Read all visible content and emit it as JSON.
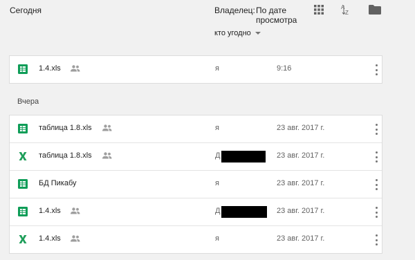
{
  "header": {
    "group_today": "Сегодня",
    "owner_label": "Владелец:",
    "owner_value": "кто угодно",
    "sort_label": "По дате просмотра",
    "icons": [
      "grid-view-icon",
      "sort-az-icon",
      "folder-icon"
    ]
  },
  "colors": {
    "sheets_green": "#0f9d58",
    "excel_green": "#1e9e5a",
    "background": "#f1f1f1"
  },
  "today": [
    {
      "name": "1.4.xls",
      "icon": "google-sheets-icon",
      "shared": true,
      "owner": "я",
      "date": "9:16"
    }
  ],
  "group_yesterday": "Вчера",
  "yesterday": [
    {
      "name": "таблица 1.8.xls",
      "icon": "google-sheets-icon",
      "shared": true,
      "owner": "я",
      "date": "23 авг. 2017 г."
    },
    {
      "name": "таблица 1.8.xls",
      "icon": "excel-icon",
      "shared": true,
      "owner": "Д",
      "owner_suffix": ".",
      "redacted": true,
      "date": "23 авг. 2017 г."
    },
    {
      "name": "БД Пикабу",
      "icon": "google-sheets-icon",
      "shared": false,
      "owner": "я",
      "date": "23 авг. 2017 г."
    },
    {
      "name": "1.4.xls",
      "icon": "google-sheets-icon",
      "shared": true,
      "owner": "Д",
      "redacted": true,
      "date": "23 авг. 2017 г."
    },
    {
      "name": "1.4.xls",
      "icon": "excel-icon",
      "shared": true,
      "owner": "я",
      "date": "23 авг. 2017 г."
    }
  ]
}
